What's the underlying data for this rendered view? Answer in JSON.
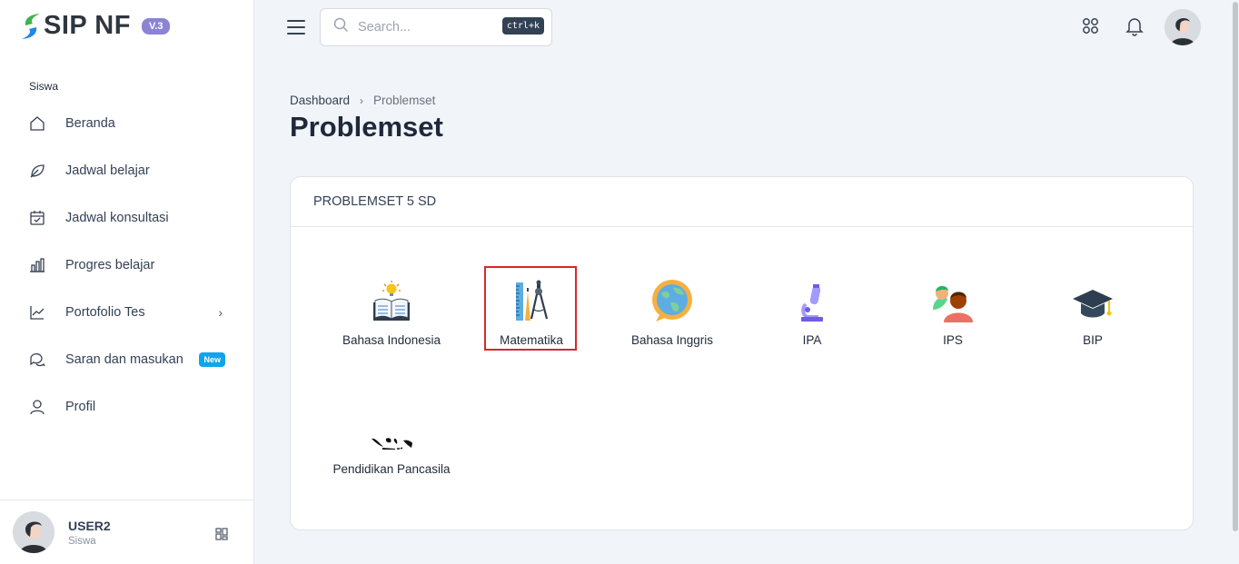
{
  "brand": {
    "name": "SIP NF",
    "version": "V.3"
  },
  "sidebar": {
    "section": "Siswa",
    "items": [
      {
        "label": "Beranda",
        "icon": "home-icon"
      },
      {
        "label": "Jadwal belajar",
        "icon": "leaf-icon"
      },
      {
        "label": "Jadwal konsultasi",
        "icon": "calendar-check-icon"
      },
      {
        "label": "Progres belajar",
        "icon": "bar-chart-icon"
      },
      {
        "label": "Portofolio Tes",
        "icon": "trend-chart-icon",
        "chevron": "›"
      },
      {
        "label": "Saran dan masukan",
        "icon": "chat-icon",
        "badge": "New"
      },
      {
        "label": "Profil",
        "icon": "user-icon"
      }
    ],
    "user": {
      "name": "USER2",
      "role": "Siswa"
    }
  },
  "topbar": {
    "search_placeholder": "Search...",
    "search_shortcut": "ctrl+k"
  },
  "breadcrumb": {
    "root": "Dashboard",
    "sep": "›",
    "current": "Problemset"
  },
  "page": {
    "title": "Problemset"
  },
  "card": {
    "title": "PROBLEMSET 5 SD",
    "subjects": [
      {
        "label": "Bahasa Indonesia",
        "icon": "book-lightbulb-icon"
      },
      {
        "label": "Matematika",
        "icon": "ruler-compass-icon"
      },
      {
        "label": "Bahasa Inggris",
        "icon": "globe-chat-icon"
      },
      {
        "label": "IPA",
        "icon": "microscope-icon"
      },
      {
        "label": "IPS",
        "icon": "people-icon"
      },
      {
        "label": "BIP",
        "icon": "graduation-cap-icon"
      },
      {
        "label": "Pendidikan Pancasila",
        "icon": "indonesia-map-icon"
      }
    ]
  },
  "colors": {
    "accent": "#8b83d4",
    "badge": "#0ea5e9",
    "highlight": "#dc2626",
    "logo_green": "#3cb44a",
    "logo_blue": "#1e88e5"
  }
}
